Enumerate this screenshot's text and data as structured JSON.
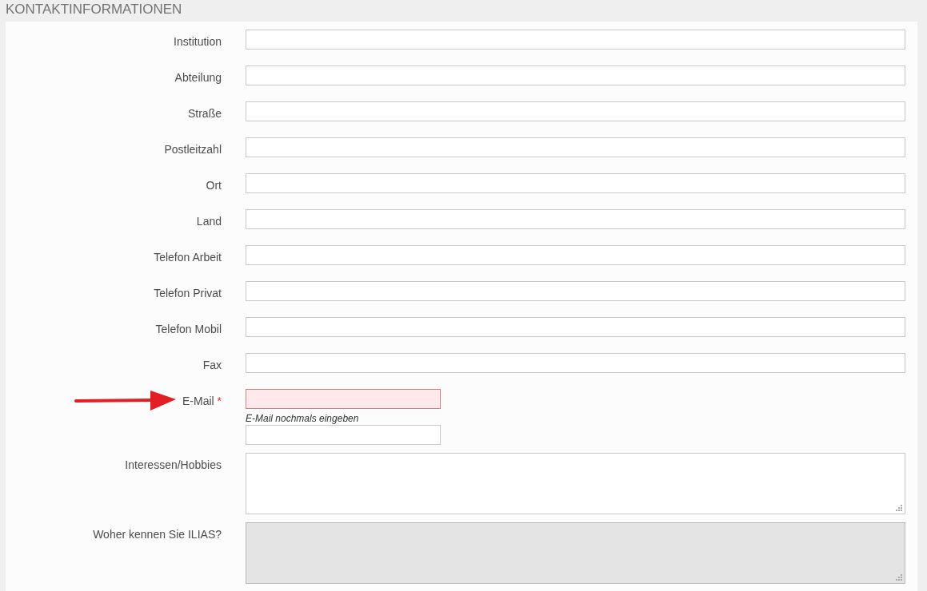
{
  "section_title": "KONTAKTINFORMATIONEN",
  "fields": [
    {
      "kind": "text",
      "label": "Institution"
    },
    {
      "kind": "text",
      "label": "Abteilung"
    },
    {
      "kind": "text",
      "label": "Straße"
    },
    {
      "kind": "text",
      "label": "Postleitzahl"
    },
    {
      "kind": "text",
      "label": "Ort"
    },
    {
      "kind": "text",
      "label": "Land"
    },
    {
      "kind": "text",
      "label": "Telefon Arbeit"
    },
    {
      "kind": "text",
      "label": "Telefon Privat"
    },
    {
      "kind": "text",
      "label": "Telefon Mobil"
    },
    {
      "kind": "text",
      "label": "Fax"
    },
    {
      "kind": "email",
      "label": "E-Mail",
      "required_mark": "*",
      "invalid": true,
      "arrow": true,
      "confirm_label": "E-Mail nochmals eingeben"
    },
    {
      "kind": "textarea",
      "label": "Interessen/Hobbies",
      "disabled": false
    },
    {
      "kind": "textarea",
      "label": "Woher kennen Sie ILIAS?",
      "disabled": true
    }
  ]
}
